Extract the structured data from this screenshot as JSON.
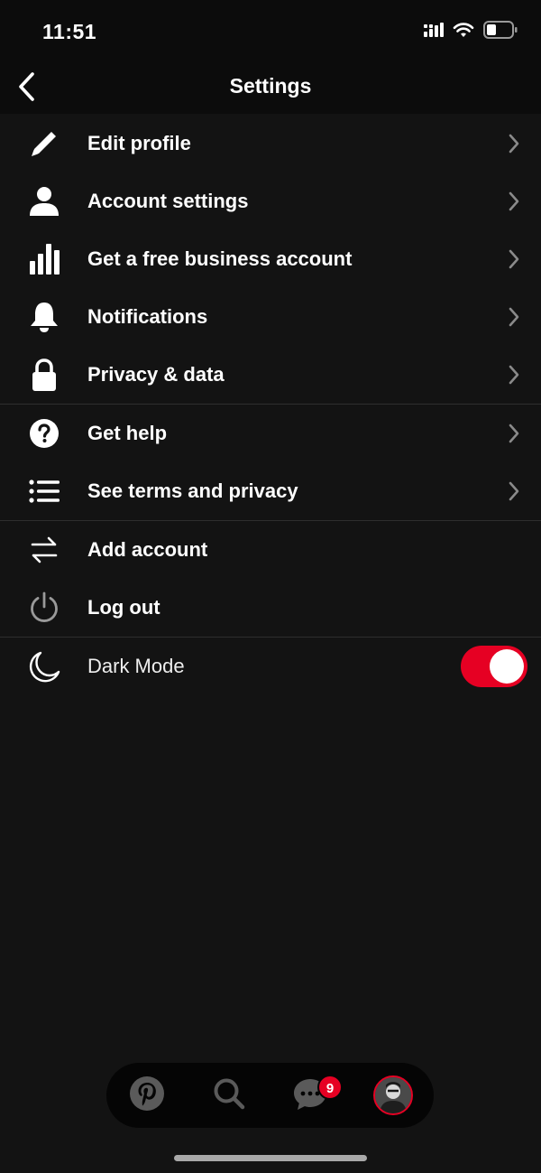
{
  "status_bar": {
    "time": "11:51"
  },
  "header": {
    "title": "Settings"
  },
  "groups": [
    [
      {
        "key": "edit-profile",
        "label": "Edit profile",
        "icon": "pencil-icon",
        "chevron": true
      },
      {
        "key": "account-settings",
        "label": "Account settings",
        "icon": "person-icon",
        "chevron": true
      },
      {
        "key": "business-account",
        "label": "Get a free business account",
        "icon": "bar-chart-icon",
        "chevron": true
      },
      {
        "key": "notifications",
        "label": "Notifications",
        "icon": "bell-icon",
        "chevron": true
      },
      {
        "key": "privacy-data",
        "label": "Privacy & data",
        "icon": "lock-icon",
        "chevron": true
      }
    ],
    [
      {
        "key": "get-help",
        "label": "Get help",
        "icon": "question-icon",
        "chevron": true
      },
      {
        "key": "terms-privacy",
        "label": "See terms and privacy",
        "icon": "list-icon",
        "chevron": true
      }
    ],
    [
      {
        "key": "add-account",
        "label": "Add account",
        "icon": "swap-arrows-icon",
        "chevron": false
      },
      {
        "key": "log-out",
        "label": "Log out",
        "icon": "power-icon",
        "chevron": false
      }
    ]
  ],
  "dark_mode": {
    "label": "Dark Mode",
    "icon": "moon-icon",
    "enabled": true
  },
  "tab_bar": {
    "tabs": [
      {
        "name": "home",
        "icon": "pinterest-logo-icon"
      },
      {
        "name": "search",
        "icon": "search-icon"
      },
      {
        "name": "messages",
        "icon": "chat-bubble-icon"
      },
      {
        "name": "profile",
        "icon": "avatar-icon"
      }
    ],
    "messages_badge": "9"
  },
  "colors": {
    "accent": "#e60023",
    "background": "#131313",
    "header": "#0c0c0c"
  }
}
